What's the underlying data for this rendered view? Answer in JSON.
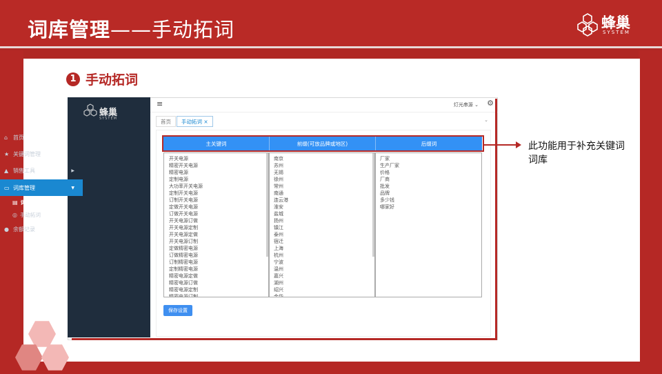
{
  "slide": {
    "title_bold": "词库管理",
    "title_light": "——手动拓词",
    "logo_name": "蜂巢",
    "logo_sub": "SYSTEM",
    "section_number": "1",
    "section_title": "手动拓词",
    "note": "此功能用于补充关键词词库"
  },
  "app": {
    "logo_name": "蜂巢",
    "logo_sub": "SYSTEM",
    "nav": [
      {
        "label": "首页",
        "icon": "home-icon"
      },
      {
        "label": "关键词管理",
        "icon": "star-icon"
      },
      {
        "label": "销售工具",
        "icon": "thumb-up-icon"
      },
      {
        "label": "词库管理",
        "icon": "chat-icon"
      },
      {
        "label": "余额记录",
        "icon": "coin-icon"
      }
    ],
    "subnav": [
      {
        "label": "词库列表",
        "icon": "list-icon"
      },
      {
        "label": "手动拓词",
        "icon": "settings-icon"
      }
    ],
    "topbar": {
      "menu_icon": "menu-icon",
      "source_select": "灯光串源",
      "gear_icon": "gear-icon"
    },
    "tabs": [
      {
        "label": "首页"
      },
      {
        "label": "手动拓词 ×"
      }
    ],
    "table": {
      "headers": [
        "主关键词",
        "前缀(可放品牌或地区)",
        "后缀词"
      ],
      "main_keywords": [
        "开关电源",
        "精密开关电源",
        "精密电源",
        "定制电源",
        "大功率开关电源",
        "定制开关电源",
        "订制开关电源",
        "定做开关电源",
        "订做开关电源",
        "开关电源订做",
        "开关电源定制",
        "开关电源定做",
        "开关电源订制",
        "定做精密电源",
        "订做精密电源",
        "订制精密电源",
        "定制精密电源",
        "精密电源定做",
        "精密电源订做",
        "精密电源定制",
        "精密电源订制"
      ],
      "prefixes": [
        "南京",
        "苏州",
        "无锡",
        "徐州",
        "常州",
        "南通",
        "连云港",
        "淮安",
        "盐城",
        "扬州",
        "镇江",
        "泰州",
        "宿迁",
        "上海",
        "杭州",
        "宁波",
        "温州",
        "嘉兴",
        "湖州",
        "绍兴",
        "金华"
      ],
      "suffixes": [
        "厂家",
        "生产厂家",
        "价格",
        "厂商",
        "批发",
        "品牌",
        "多少钱",
        "哪家好"
      ]
    },
    "save_button": "保存设置"
  },
  "colors": {
    "brand_red": "#b52825",
    "sidebar": "#1f2d3d",
    "accent_blue": "#3391f5"
  }
}
